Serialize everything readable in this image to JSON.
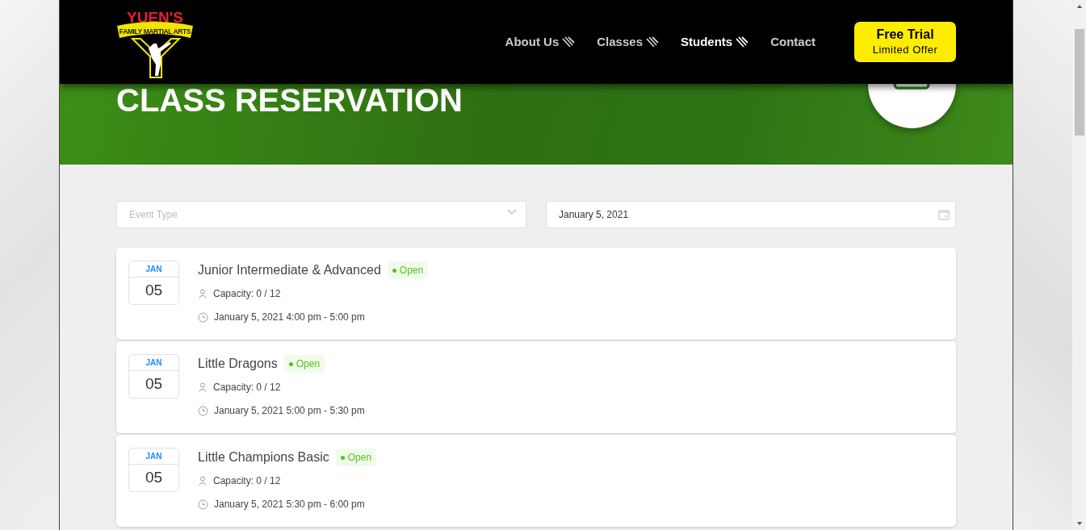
{
  "logo": {
    "name": "YUEN'S",
    "tagline": "FAMILY MARTIAL ARTS"
  },
  "nav": [
    {
      "label": "About Us",
      "kind": "menu",
      "selected": false
    },
    {
      "label": "Classes",
      "kind": "menu",
      "selected": false
    },
    {
      "label": "Students",
      "kind": "menu",
      "selected": true
    },
    {
      "label": "Contact",
      "kind": "link",
      "selected": false
    }
  ],
  "cta": {
    "title": "Free Trial",
    "subtitle": "Limited Offer"
  },
  "banner": {
    "title": "CLASS RESERVATION"
  },
  "filters": {
    "event_type": {
      "placeholder": "Event Type"
    },
    "date": {
      "value": "January 5, 2021"
    }
  },
  "events": [
    {
      "month": "JAN",
      "day": "05",
      "title": "Junior Intermediate & Advanced",
      "status": "Open",
      "capacity": "Capacity: 0 / 12",
      "time": "January 5, 2021 4:00 pm - 5:00 pm"
    },
    {
      "month": "JAN",
      "day": "05",
      "title": "Little Dragons",
      "status": "Open",
      "capacity": "Capacity: 0 / 12",
      "time": "January 5, 2021 5:00 pm - 5:30 pm"
    },
    {
      "month": "JAN",
      "day": "05",
      "title": "Little Champions Basic",
      "status": "Open",
      "capacity": "Capacity: 0 / 12",
      "time": "January 5, 2021 5:30 pm - 6:00 pm"
    }
  ]
}
